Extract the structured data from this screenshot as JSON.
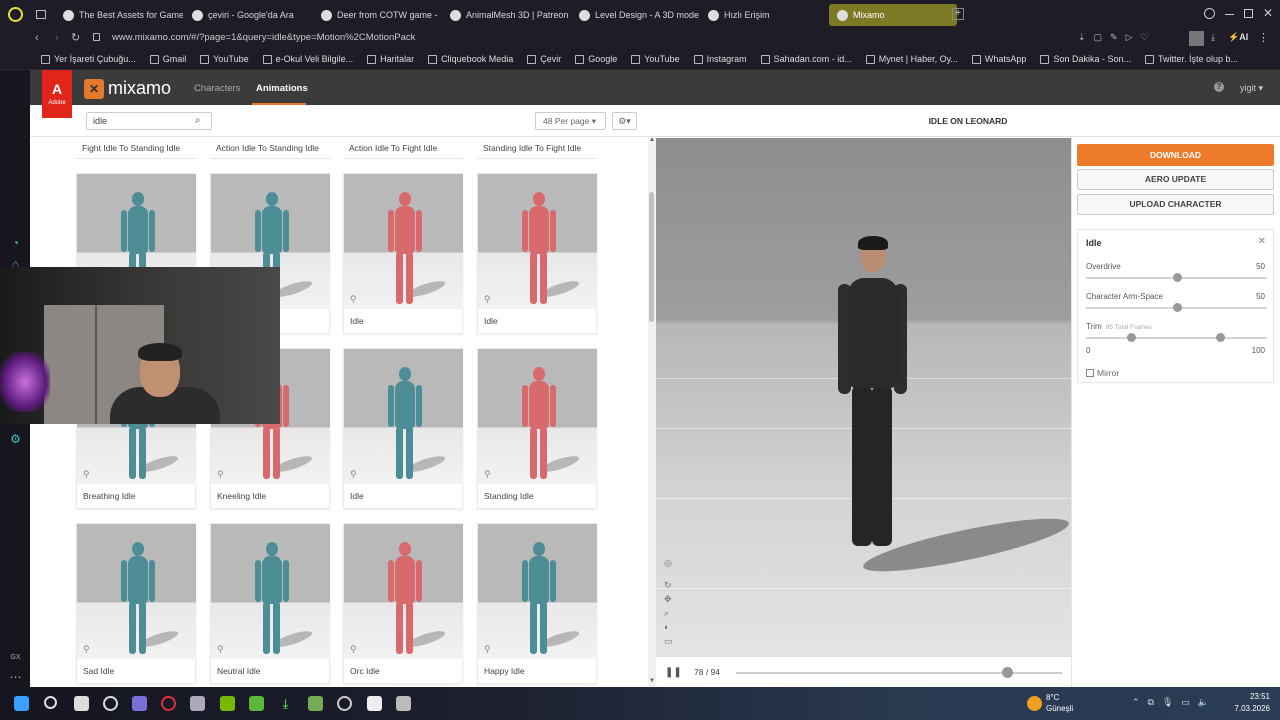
{
  "browser": {
    "tabs": [
      {
        "label": "The Best Assets for Game",
        "icon": "tab-favicon"
      },
      {
        "label": "çeviri - Google'da Ara",
        "icon": "google-icon"
      },
      {
        "label": "Deer from COTW game - ",
        "icon": "tab-favicon"
      },
      {
        "label": "AnimalMesh 3D | Patreon",
        "icon": "patreon-icon"
      },
      {
        "label": "Level Design - A 3D mode",
        "icon": "tab-favicon"
      },
      {
        "label": "Hızlı Erişim",
        "icon": "grid-icon"
      },
      {
        "label": "Mixamo",
        "icon": "mixamo-icon",
        "active": true
      }
    ],
    "url": "www.mixamo.com/#/?page=1&query=idle&type=Motion%2CMotionPack",
    "bookmarks": [
      "Yer İşareti Çubuğu...",
      "Gmail",
      "YouTube",
      "e-Okul Veli Bilgile...",
      "Haritalar",
      "Cliquebook Media",
      "Çevir",
      "Google",
      "YouTube",
      "Instagram",
      "Sahadan.com - id...",
      "Mynet | Haber, Oy...",
      "WhatsApp",
      "Son Dakika - Son...",
      "Twitter. İşte olup b..."
    ]
  },
  "mixamo": {
    "brand": "mixamo",
    "adobe": "Adobe",
    "nav": {
      "characters": "Characters",
      "animations": "Animations"
    },
    "user": "yigit",
    "search": {
      "value": "idle"
    },
    "per_page": "48 Per page",
    "top_labels": [
      "Fight Idle To Standing Idle",
      "Action Idle To Standing Idle",
      "Action Idle To Fight Idle",
      "Standing Idle To Fight Idle"
    ],
    "cards": [
      {
        "label": "",
        "color": "teal"
      },
      {
        "label": "",
        "color": "teal"
      },
      {
        "label": "Idle",
        "color": "red"
      },
      {
        "label": "Idle",
        "color": "red"
      },
      {
        "label": "Breathing Idle",
        "color": "teal"
      },
      {
        "label": "Kneeling Idle",
        "color": "red"
      },
      {
        "label": "Idle",
        "color": "teal"
      },
      {
        "label": "Standing Idle",
        "color": "red"
      },
      {
        "label": "Sad Idle",
        "color": "teal"
      },
      {
        "label": "Neutral Idle",
        "color": "teal"
      },
      {
        "label": "Orc Idle",
        "color": "red"
      },
      {
        "label": "Happy Idle",
        "color": "teal"
      }
    ],
    "viewer_title": "IDLE ON LEONARD",
    "timeline": {
      "frame": "78 / 94",
      "progress": 0.83
    },
    "buttons": {
      "download": "DOWNLOAD",
      "aero_update": "AERO UPDATE",
      "upload": "UPLOAD CHARACTER"
    },
    "panel": {
      "title": "Idle",
      "overdrive": {
        "label": "Overdrive",
        "value": "50",
        "level": 0.5
      },
      "arm_space": {
        "label": "Character Arm-Space",
        "value": "50",
        "level": 0.5
      },
      "trim": {
        "label": "Trim",
        "sub": "95 Total Frames",
        "min": "0",
        "max": "100",
        "start": 0.25,
        "end": 0.74
      },
      "mirror": "Mirror"
    },
    "colors": {
      "accent": "#ee7b29",
      "header": "#3b3b3b",
      "adobe": "#e1251b"
    }
  },
  "taskbar": {
    "weather_temp": "8°C",
    "weather_text": "Güneşli",
    "time": "23:51",
    "date": "7.03.2026"
  }
}
